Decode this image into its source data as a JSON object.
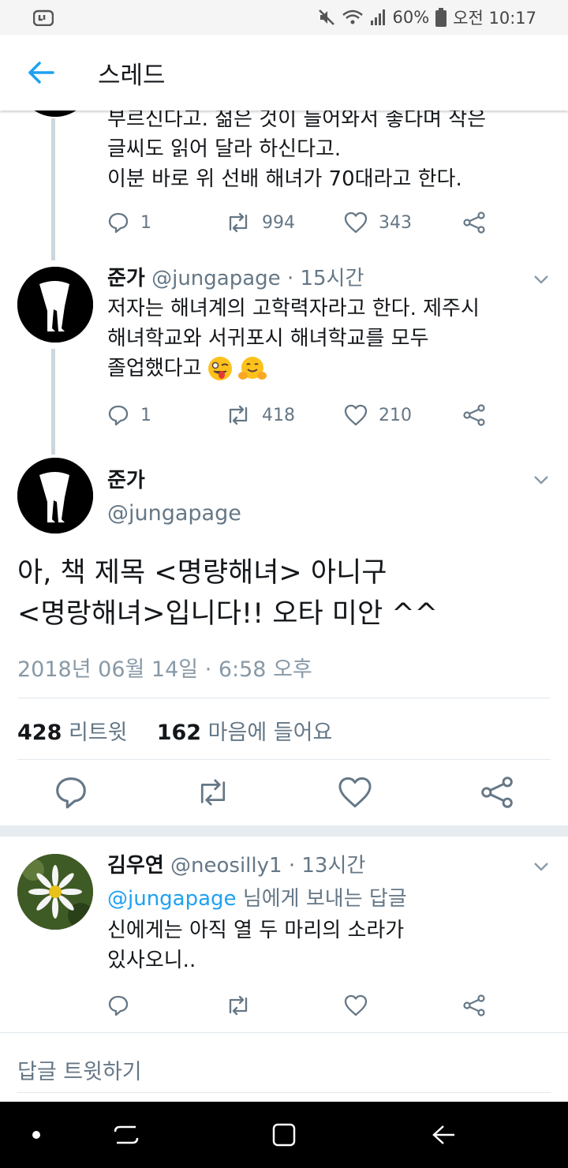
{
  "status_bar": {
    "battery": "60%",
    "time": "오전 10:17",
    "icons": [
      "app-notification-icon",
      "mute-icon",
      "wifi-icon",
      "signal-icon",
      "battery-icon"
    ]
  },
  "header": {
    "title": "스레드",
    "back_icon": "back-arrow-icon"
  },
  "previous_tweet": {
    "lines": [
      "부르신다고. 젊은 것이 들어와서 좋다며 작은",
      "글씨도 읽어 달라 하신다고.",
      "이분 바로 위 선배 해녀가 70대라고 한다."
    ],
    "replies": "1",
    "retweets": "994",
    "likes": "343"
  },
  "tweet_2": {
    "name": "준가",
    "handle": "@jungapage",
    "time": "· 15시간",
    "lines": [
      "저자는 해녀계의 고학력자라고 한다. 제주시",
      "해녀학교와 서귀포시 해녀학교를 모두",
      "졸업했다고"
    ],
    "emoji": [
      "winking-tongue-face",
      "hugging-face"
    ],
    "replies": "1",
    "retweets": "418",
    "likes": "210"
  },
  "main_tweet": {
    "name": "준가",
    "handle": "@jungapage",
    "lines": [
      "아, 책 제목  <명량해녀> 아니구",
      "<명랑해녀>입니다!! 오타 미안 ^^"
    ],
    "date": "2018년 06월 14일 · 6:58 오후",
    "retweet_count": "428",
    "retweet_label": "리트윗",
    "like_count": "162",
    "like_label": "마음에 들어요"
  },
  "reply_tweet": {
    "name": "김우연",
    "handle": "@neosilly1",
    "time": "· 13시간",
    "reply_to_handle": "@jungapage",
    "reply_to_suffix": "님에게 보내는 답글",
    "lines": [
      "신에게는  아직  열 두 마리의 소라가",
      "있사오니.."
    ]
  },
  "reply_box": {
    "placeholder": "답글 트윗하기"
  },
  "colors": {
    "brand_blue": "#1da1f2",
    "text": "#14171a",
    "secondary": "#657786",
    "divider": "#e1e8ed"
  }
}
